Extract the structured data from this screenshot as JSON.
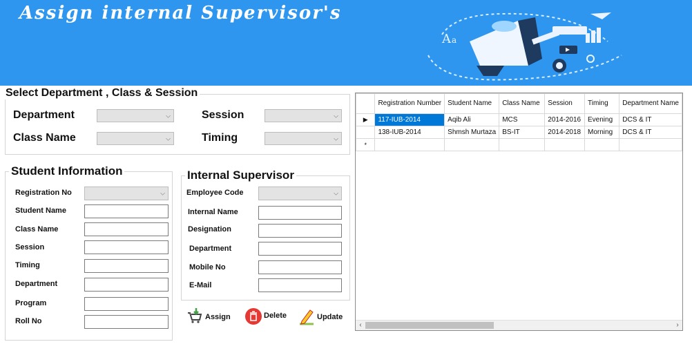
{
  "banner": {
    "title": "Assign internal Supervisor's"
  },
  "selection": {
    "title": "Select Department , Class & Session",
    "department_label": "Department",
    "class_label": "Class Name",
    "session_label": "Session",
    "timing_label": "Timing"
  },
  "student": {
    "title": "Student Information",
    "labels": {
      "registration": "Registration No",
      "name": "Student Name",
      "class": "Class Name",
      "session": "Session",
      "timing": "Timing",
      "department": "Department",
      "program": "Program",
      "roll": "Roll No"
    }
  },
  "supervisor": {
    "title": "Internal Supervisor",
    "labels": {
      "employee_code": "Employee Code",
      "internal_name": "Internal Name",
      "designation": "Designation",
      "department": "Department",
      "mobile": "Mobile No",
      "email": "E-Mail"
    }
  },
  "buttons": {
    "assign": "Assign",
    "delete": "Delete",
    "update": "Update"
  },
  "grid": {
    "columns": [
      "Registration Number",
      "Student Name",
      "Class Name",
      "Session",
      "Timing",
      "Department Name"
    ],
    "rows": [
      [
        "117-IUB-2014",
        "Aqib Ali",
        "MCS",
        "2014-2016",
        "Evening",
        "DCS & IT"
      ],
      [
        "138-IUB-2014",
        "Shmsh Murtaza",
        "BS-IT",
        "2014-2018",
        "Morning",
        "DCS & IT"
      ]
    ],
    "current_row_marker": "▶",
    "new_row_marker": "*"
  },
  "colors": {
    "banner": "#2f96f0",
    "selection": "#0078d7",
    "delete": "#e53935"
  },
  "icons": [
    "megaphone-illustration",
    "cart-arrow-icon",
    "trash-icon",
    "pencil-edit-icon",
    "scroll-left-icon",
    "scroll-right-icon"
  ]
}
